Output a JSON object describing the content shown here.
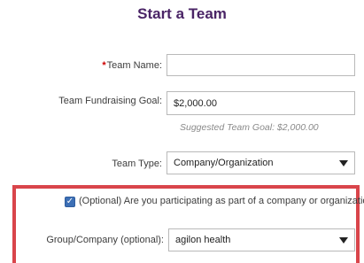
{
  "title": "Start a Team",
  "team_name": {
    "label": "Team Name:",
    "required_mark": "*",
    "value": ""
  },
  "goal": {
    "label": "Team Fundraising Goal:",
    "value": "$2,000.00",
    "hint": "Suggested Team Goal: $2,000.00"
  },
  "team_type": {
    "label": "Team Type:",
    "value": "Company/Organization"
  },
  "company_question": {
    "label": "(Optional) Are you participating as part of a company or organization?",
    "checked": true,
    "check_glyph": "✓"
  },
  "company": {
    "label": "Group/Company (optional):",
    "value": "agilon health"
  },
  "colors": {
    "title": "#4a2466",
    "highlight": "#d9454b",
    "checkbox": "#3c6fb5"
  }
}
